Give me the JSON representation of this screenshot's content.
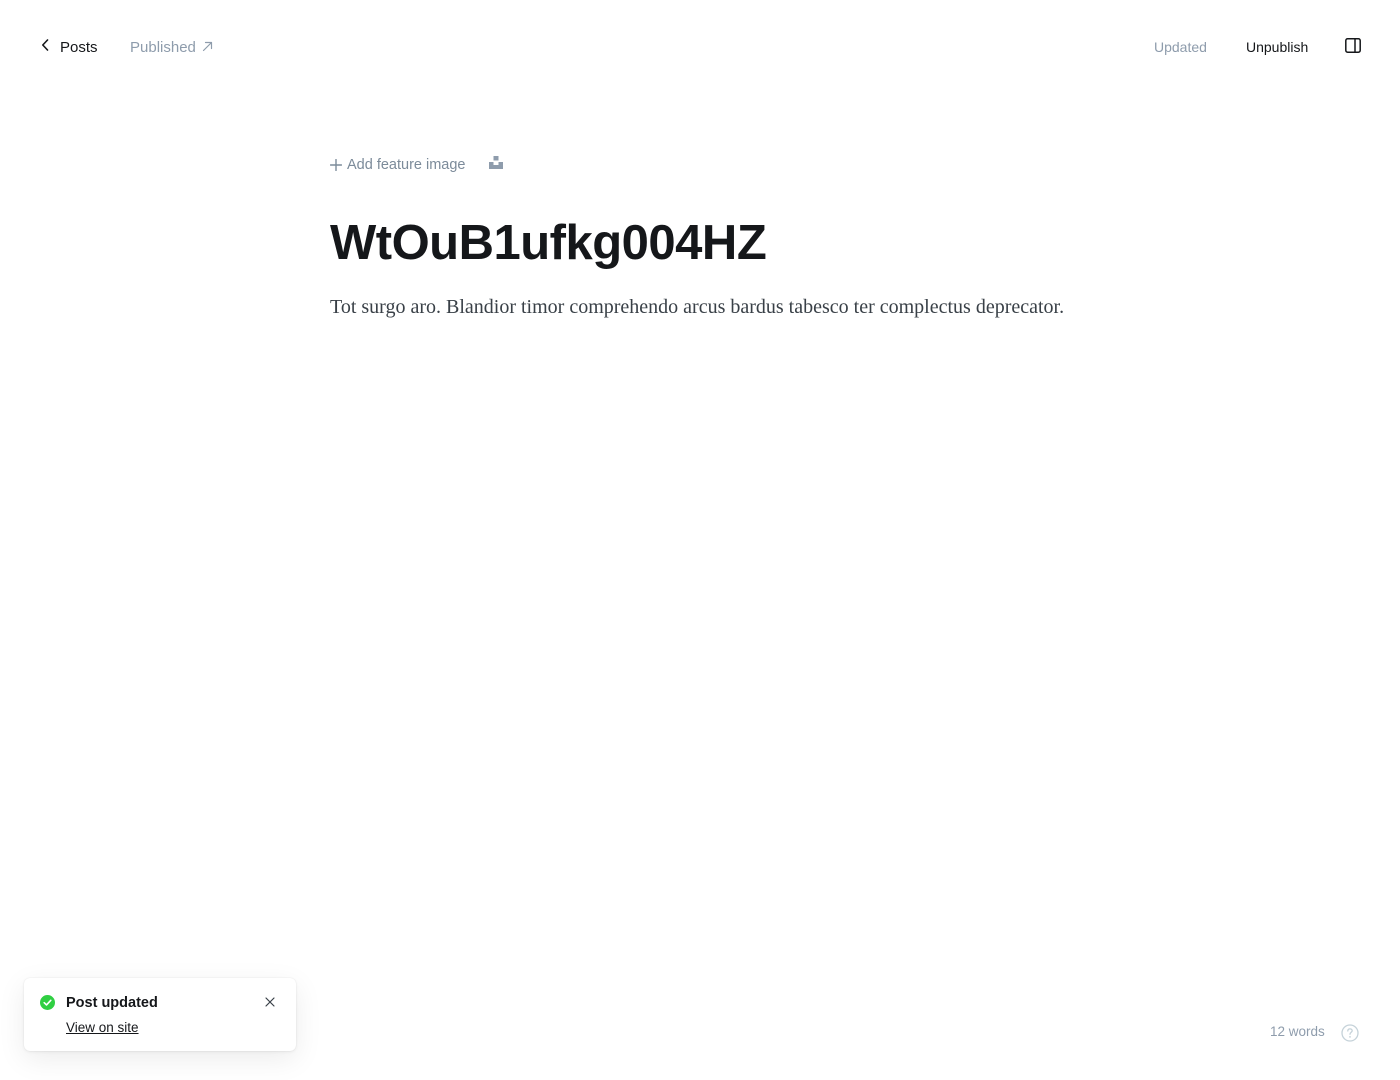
{
  "header": {
    "back_label": "Posts",
    "status_label": "Published",
    "save_state": "Updated",
    "unpublish_label": "Unpublish"
  },
  "editor": {
    "add_feature_image_label": "Add feature image",
    "title": "WtOuB1ufkg004HZ",
    "body": "Tot surgo aro. Blandior timor comprehendo arcus bardus tabesco ter complectus deprecator."
  },
  "toast": {
    "title": "Post updated",
    "link_label": "View on site"
  },
  "footer": {
    "word_count": "12 words"
  },
  "icons": {
    "back": "chevron-left-icon",
    "status": "arrow-up-right-icon",
    "sidebar": "sidebar-toggle-icon",
    "feature_add": "plus-icon",
    "unsplash": "unsplash-icon",
    "toast_status": "check-circle-icon",
    "toast_close": "close-icon",
    "help": "help-circle-icon"
  },
  "colors": {
    "text": "#15171a",
    "muted": "#8e9cac",
    "success": "#30cf43"
  }
}
